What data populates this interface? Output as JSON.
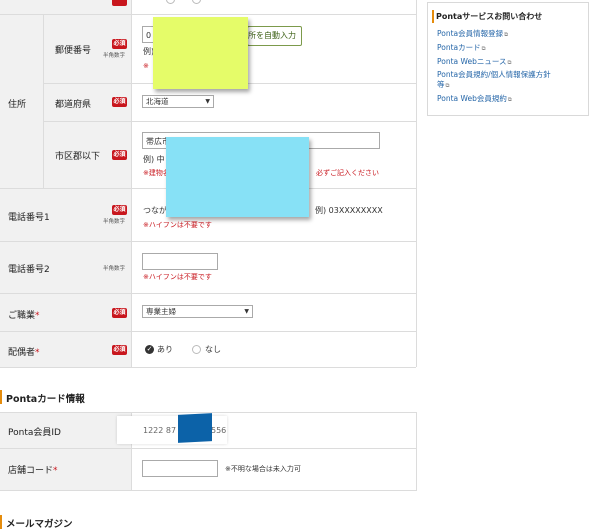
{
  "form": {
    "rows": {
      "address_group_label": "住所",
      "postal": {
        "label": "郵便番号",
        "required": "必須",
        "sub": "半角数字",
        "value": "0",
        "example": "例)",
        "note": "※",
        "auto_button": "所を自動入力"
      },
      "prefecture": {
        "label": "都道府県",
        "required": "必須",
        "value": "北海道"
      },
      "city": {
        "label": "市区郡以下",
        "required": "必須",
        "value": "帯広市",
        "example": "例) 中",
        "note_left": "※建物名",
        "note_right": "必ずご記入ください"
      },
      "phone1": {
        "label": "電話番号1",
        "required": "必須",
        "sub": "半角数字",
        "prefix": "つなが",
        "example": "例) 03XXXXXXXX",
        "note": "※ハイフンは不要です"
      },
      "phone2": {
        "label": "電話番号2",
        "sub": "半角数字",
        "note": "※ハイフンは不要です"
      },
      "occupation": {
        "label": "ご職業",
        "star": "*",
        "required": "必須",
        "value": "専業主婦"
      },
      "spouse": {
        "label": "配偶者",
        "star": "*",
        "required": "必須",
        "option_yes": "あり",
        "option_no": "なし"
      }
    }
  },
  "ponta_section": {
    "title": "Pontaカード情報",
    "member_id_label": "Ponta会員ID",
    "member_id_left": "1222 87",
    "member_id_right": "556",
    "store_code_label": "店舗コード",
    "star": "*",
    "store_code_note": "※不明な場合は未入力可"
  },
  "mail_section": {
    "title": "メールマガジン"
  },
  "sidebar": {
    "title": "Pontaサービスお問い合わせ",
    "links": [
      "Ponta会員情報登録",
      "Pontaカード",
      "Ponta Webニュース",
      "Ponta会員規約/個人情報保護方針",
      "等",
      "Ponta Web会員規約"
    ]
  },
  "colors": {
    "required_badge": "#c8161d",
    "accent_bar": "#e58c0c",
    "link": "#2566a8",
    "label_bg": "#f1f1f1",
    "sticky_yellow": "#e5fc69",
    "sticky_blue": "#87e1f6",
    "redaction_blue": "#0c62a8"
  },
  "icons": {
    "external_link": "external-link-icon",
    "select_arrow": "chevron-down-icon",
    "radio_checked": "check-circle-icon"
  }
}
